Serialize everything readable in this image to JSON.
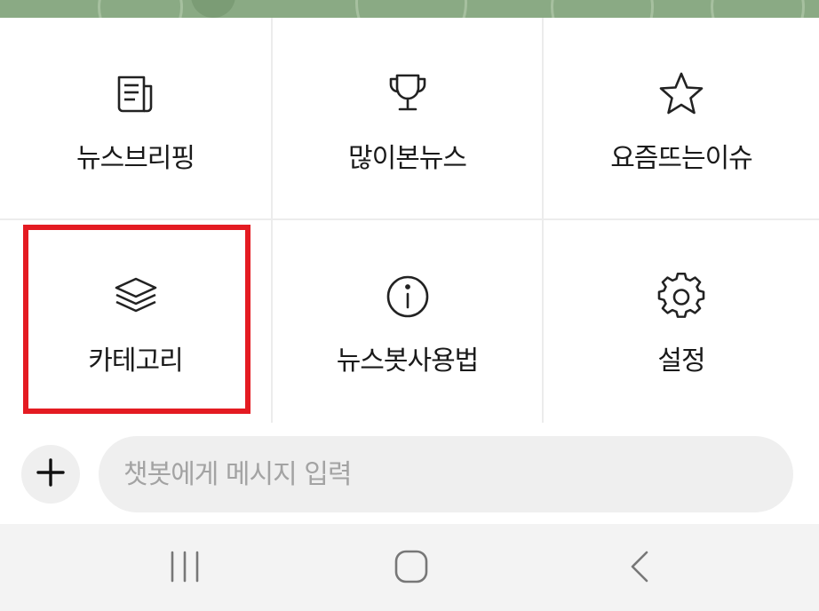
{
  "menu": {
    "items": [
      {
        "id": "news-briefing",
        "label": "뉴스브리핑",
        "icon": "newspaper-icon"
      },
      {
        "id": "most-viewed",
        "label": "많이본뉴스",
        "icon": "trophy-icon"
      },
      {
        "id": "trending",
        "label": "요즘뜨는이슈",
        "icon": "star-icon"
      },
      {
        "id": "category",
        "label": "카테고리",
        "icon": "layers-icon",
        "highlighted": true
      },
      {
        "id": "how-to",
        "label": "뉴스봇사용법",
        "icon": "info-icon"
      },
      {
        "id": "settings",
        "label": "설정",
        "icon": "gear-icon"
      }
    ]
  },
  "composer": {
    "placeholder": "챗봇에게 메시지 입력",
    "add_icon": "plus-icon"
  },
  "system_nav": {
    "recents_icon": "recents-icon",
    "home_icon": "home-icon",
    "back_icon": "back-icon"
  },
  "colors": {
    "banner": "#8aaa84",
    "highlight": "#e41b22",
    "input_bg": "#efefef",
    "navbar_bg": "#f3f3f3"
  }
}
